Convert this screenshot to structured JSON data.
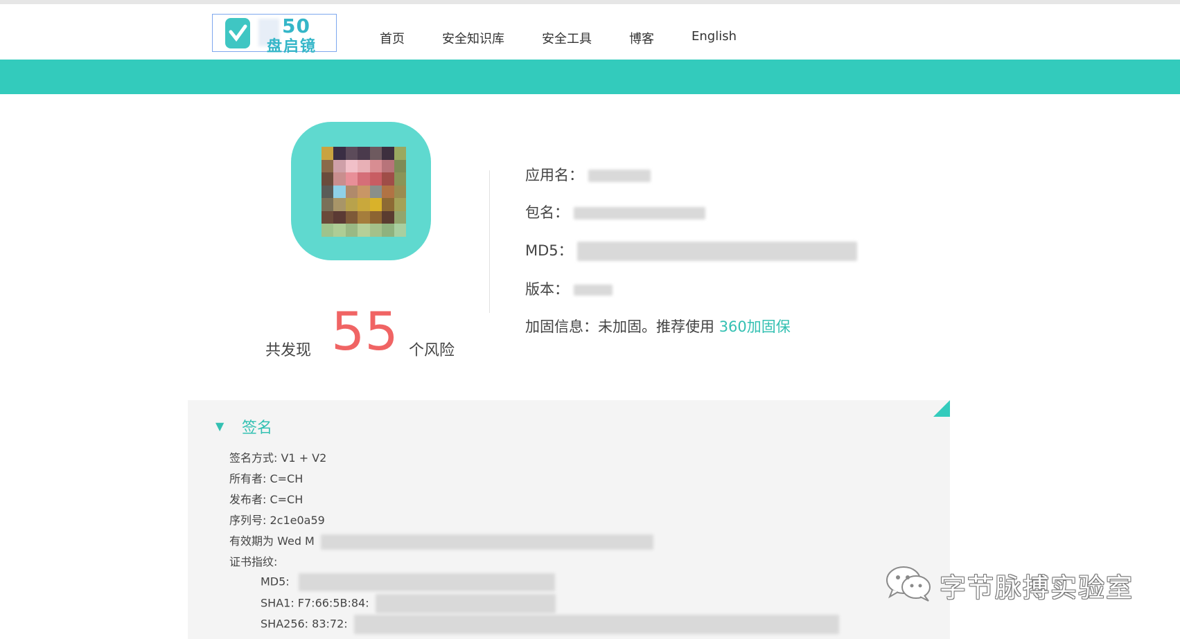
{
  "nav": {
    "logo_digits": "50",
    "logo_sub": "盘启镜",
    "items": [
      {
        "label": "首页"
      },
      {
        "label": "安全知识库"
      },
      {
        "label": "安全工具"
      },
      {
        "label": "博客"
      },
      {
        "label": "English"
      }
    ]
  },
  "summary": {
    "prefix": "共发现",
    "risk_count": "55",
    "suffix": "个风险"
  },
  "app_info": {
    "name_label": "应用名：",
    "package_label": "包名：",
    "md5_label": "MD5：",
    "version_label": "版本：",
    "protection_label": "加固信息：",
    "protection_value": "未加固。推荐使用",
    "protection_link": "360加固保"
  },
  "signature": {
    "title": "签名",
    "method": "签名方式: V1 + V2",
    "owner": "所有者: C=CH",
    "issuer": "发布者: C=CH",
    "serial": "序列号: 2c1e0a59",
    "validity": "有效期为 Wed M",
    "fingerprint_label": "证书指纹:",
    "md5": "MD5:",
    "sha1": "SHA1: F7:66:5B:84:",
    "sha256": "SHA256: 83:72:"
  },
  "watermark": {
    "text": "字节脉搏实验室",
    "icon": "wechat-icon"
  },
  "colors": {
    "accent": "#33cbbc",
    "risk": "#f06464",
    "link": "#33c0b2"
  }
}
